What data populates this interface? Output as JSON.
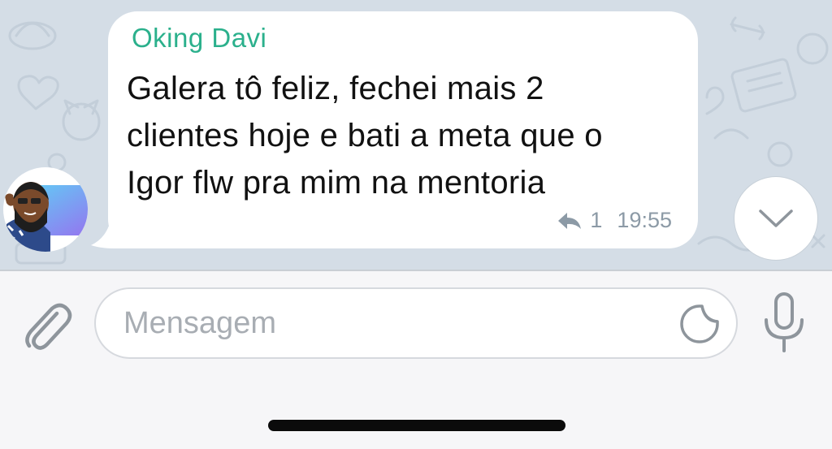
{
  "message": {
    "sender": "Oking Davi",
    "lines": [
      "Galera tô feliz, fechei mais 2",
      "clientes hoje e bati a meta que o",
      "Igor flw pra mim na mentoria"
    ],
    "reply_count": "1",
    "time": "19:55"
  },
  "composer": {
    "placeholder": "Mensagem"
  },
  "icons": {
    "reply": "reply-arrow-icon",
    "scroll": "chevron-down-icon",
    "attach": "paperclip-icon",
    "sticker": "sticker-icon",
    "mic": "microphone-icon"
  },
  "colors": {
    "sender_name": "#2bb08c",
    "chat_background": "#d4dde6",
    "bubble": "#ffffff",
    "meta_text": "#8c9aa6",
    "icon_gray": "#8e959c"
  }
}
